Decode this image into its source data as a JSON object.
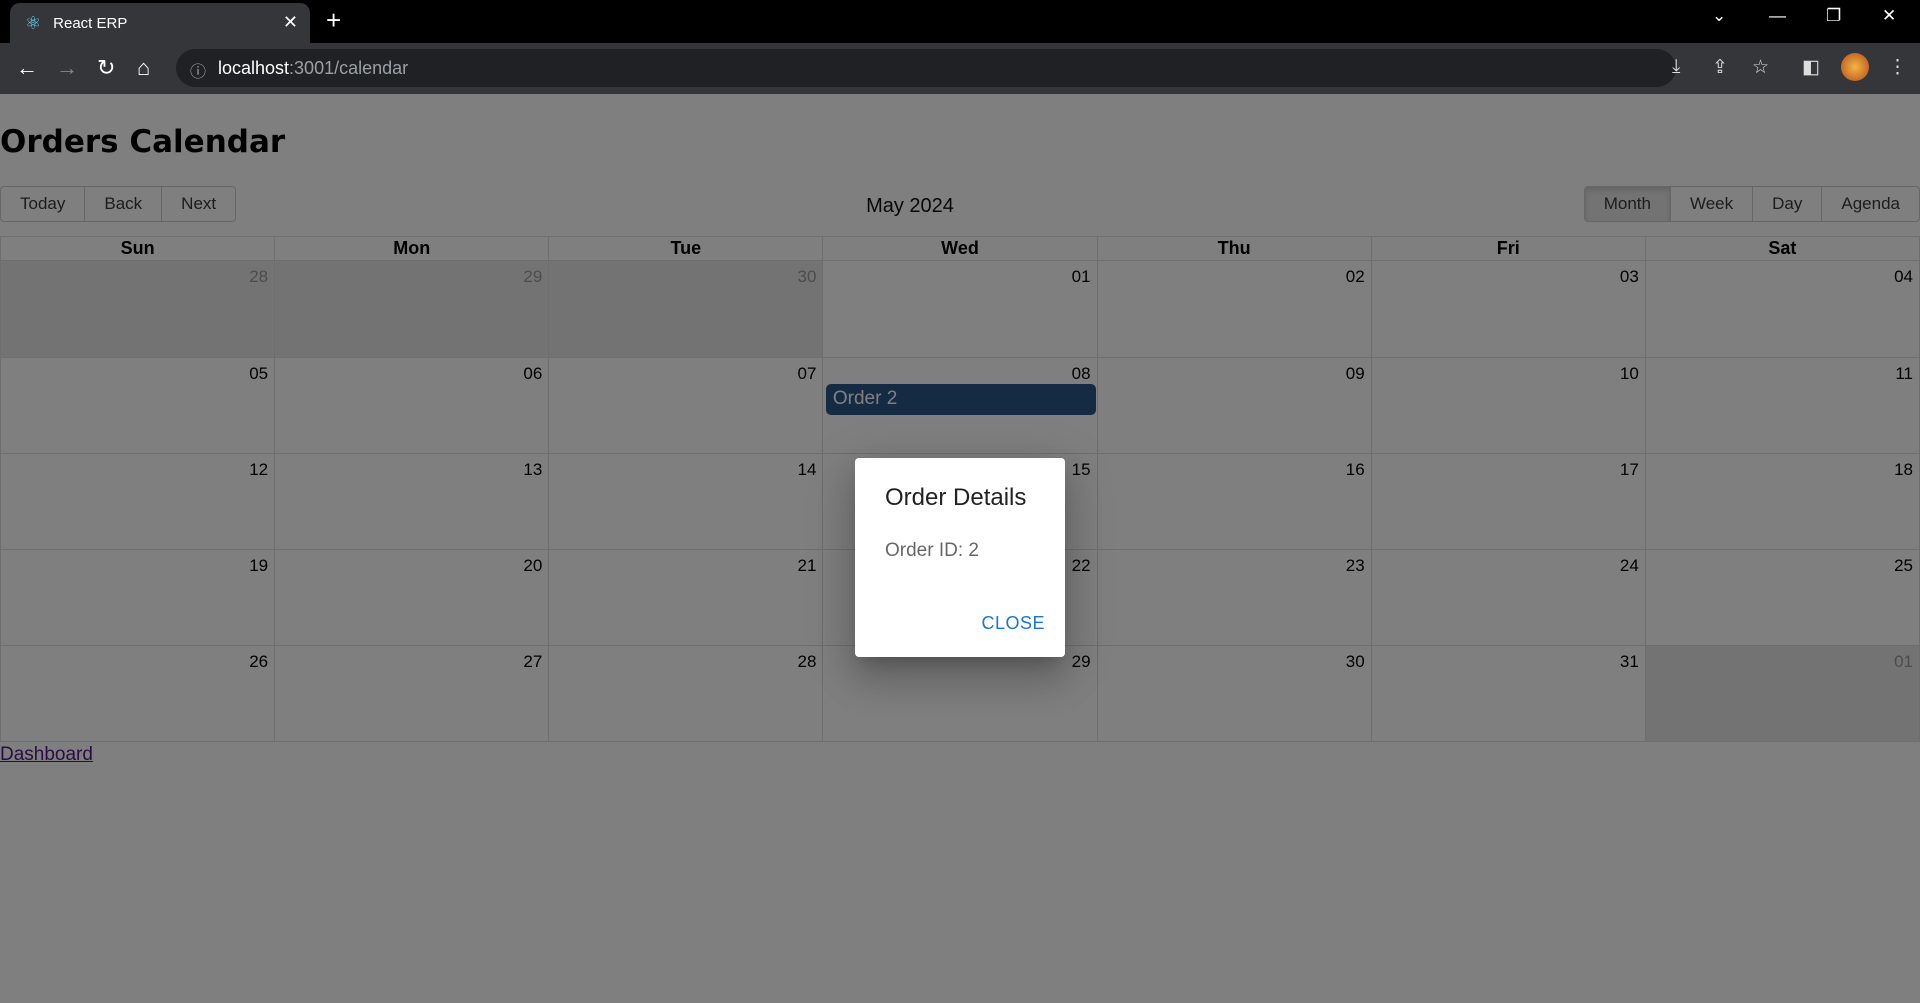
{
  "browser": {
    "tab_title": "React ERP",
    "url_host": "localhost",
    "url_path": ":3001/calendar"
  },
  "page": {
    "title": "Orders Calendar",
    "nav": [
      "Today",
      "Back",
      "Next"
    ],
    "label": "May 2024",
    "views": [
      "Month",
      "Week",
      "Day",
      "Agenda"
    ],
    "active_view": "Month",
    "footer_link": "Dashboard"
  },
  "calendar": {
    "weekdays": [
      "Sun",
      "Mon",
      "Tue",
      "Wed",
      "Thu",
      "Fri",
      "Sat"
    ],
    "weeks": [
      [
        "28",
        "29",
        "30",
        "01",
        "02",
        "03",
        "04"
      ],
      [
        "05",
        "06",
        "07",
        "08",
        "09",
        "10",
        "11"
      ],
      [
        "12",
        "13",
        "14",
        "15",
        "16",
        "17",
        "18"
      ],
      [
        "19",
        "20",
        "21",
        "22",
        "23",
        "24",
        "25"
      ],
      [
        "26",
        "27",
        "28",
        "29",
        "30",
        "31",
        "01"
      ]
    ],
    "event": {
      "title": "Order 2",
      "color": "#2b5787"
    }
  },
  "dialog": {
    "title": "Order Details",
    "content": "Order ID: 2",
    "close": "CLOSE"
  }
}
